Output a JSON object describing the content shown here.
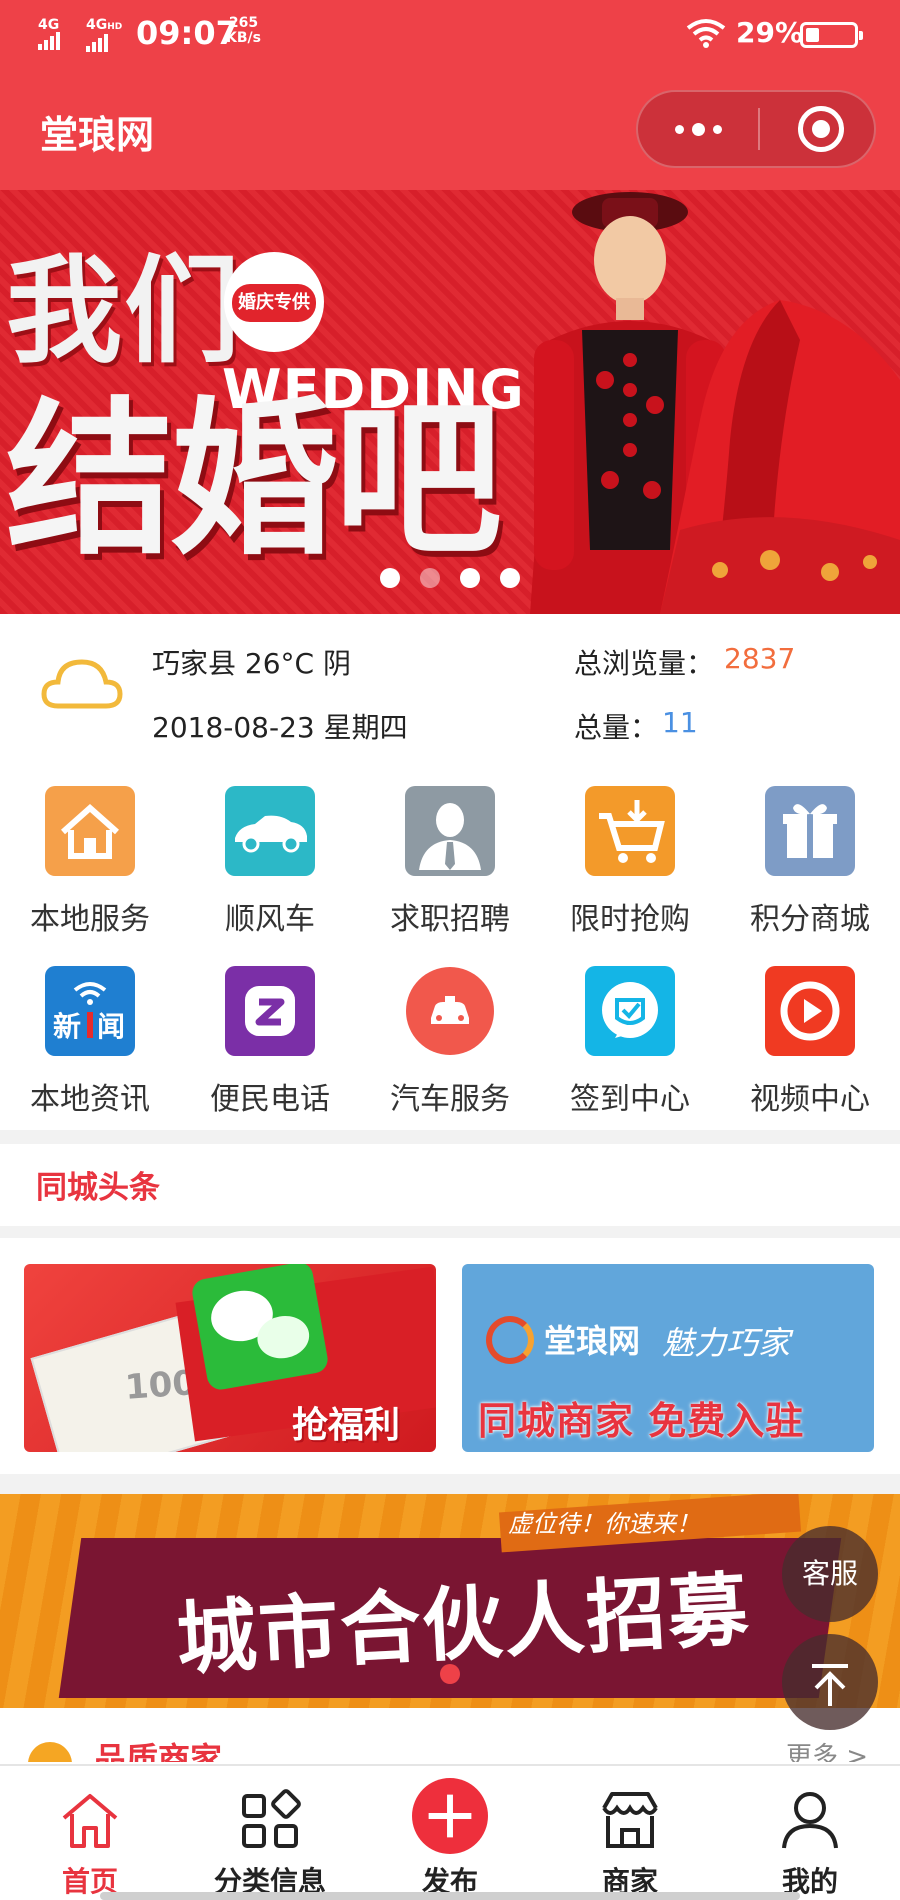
{
  "status_bar": {
    "net1": "4G",
    "net2": "4G",
    "net2_sup": "HD",
    "time": "09:07",
    "speed_value": "265",
    "speed_unit": "KB/s",
    "battery_pct": "29%",
    "battery_level": 0.29
  },
  "header": {
    "title": "堂琅网"
  },
  "banner": {
    "line1": "我们",
    "line2": "结婚吧",
    "english": "WEDDING",
    "badge": "婚庆专供",
    "slide_count": 4,
    "active_slide": 2
  },
  "info": {
    "weather": "巧家县 26°C 阴",
    "date": "2018-08-23 星期四",
    "views_label": "总浏览量：",
    "views_value": "2837",
    "total_label": "总量：",
    "total_value": "11"
  },
  "grid": {
    "items": [
      {
        "label": "本地服务",
        "color": "#f5a04a",
        "icon": "house-icon"
      },
      {
        "label": "顺风车",
        "color": "#2cb8c7",
        "icon": "car-icon"
      },
      {
        "label": "求职招聘",
        "color": "#8e9aa3",
        "icon": "person-icon"
      },
      {
        "label": "限时抢购",
        "color": "#f39a2a",
        "icon": "cart-icon"
      },
      {
        "label": "积分商城",
        "color": "#7e9cc6",
        "icon": "gift-icon"
      },
      {
        "label": "本地资讯",
        "color": "#1f7fd1",
        "icon": "news-icon"
      },
      {
        "label": "便民电话",
        "color": "#7b2fa7",
        "icon": "phone-app-icon"
      },
      {
        "label": "汽车服务",
        "color": "#f1584c",
        "icon": "car-service-icon"
      },
      {
        "label": "签到中心",
        "color": "#14b5e6",
        "icon": "checkin-icon"
      },
      {
        "label": "视频中心",
        "color": "#f03a22",
        "icon": "video-icon"
      }
    ]
  },
  "section": {
    "headline": "同城头条"
  },
  "promo": {
    "left_cta": "抢福利",
    "left_note": "100",
    "right_brand": "堂琅网",
    "right_slogan": "魅力巧家",
    "right_cta": "同城商家 免费入驻"
  },
  "partner": {
    "tag": "虚位待！你速来！",
    "headline": "城市合伙人招募"
  },
  "floating": {
    "service": "客服"
  },
  "next_section": {
    "title": "品质商家",
    "more": "更多 >"
  },
  "tabbar": {
    "tabs": [
      {
        "label": "首页",
        "icon": "home-icon",
        "active": true
      },
      {
        "label": "分类信息",
        "icon": "category-icon",
        "active": false
      },
      {
        "label": "发布",
        "icon": "publish-icon",
        "active": false
      },
      {
        "label": "商家",
        "icon": "shop-icon",
        "active": false
      },
      {
        "label": "我的",
        "icon": "profile-icon",
        "active": false
      }
    ]
  },
  "colors": {
    "brand_red": "#ee4148",
    "accent_orange": "#f26d3d",
    "accent_blue": "#4a90e2"
  }
}
